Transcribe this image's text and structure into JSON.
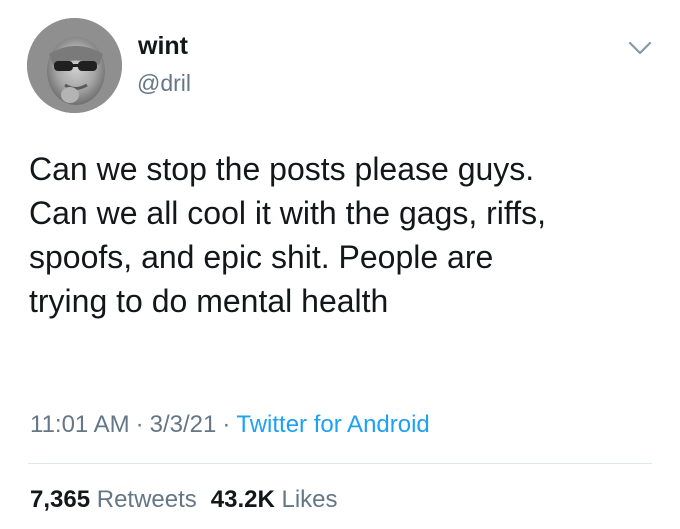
{
  "tweet": {
    "author": {
      "name": "wint",
      "handle": "@dril",
      "avatar_icon": "avatar-photo"
    },
    "text_lines": [
      "Can we stop the posts please guys.",
      "Can we all cool it with the gags, riffs,",
      "spoofs, and epic shit. People are",
      "trying to do mental health"
    ],
    "time": "11:01 AM",
    "date": "3/3/21",
    "separator": "·",
    "source": "Twitter for Android",
    "stats": {
      "retweets_count": "7,365",
      "retweets_label": "Retweets",
      "likes_count": "43.2K",
      "likes_label": "Likes"
    },
    "menu_icon": "chevron-down-icon",
    "colors": {
      "text": "#14171a",
      "muted": "#657786",
      "link": "#1da1f2",
      "divider": "#e1e8ed"
    }
  }
}
